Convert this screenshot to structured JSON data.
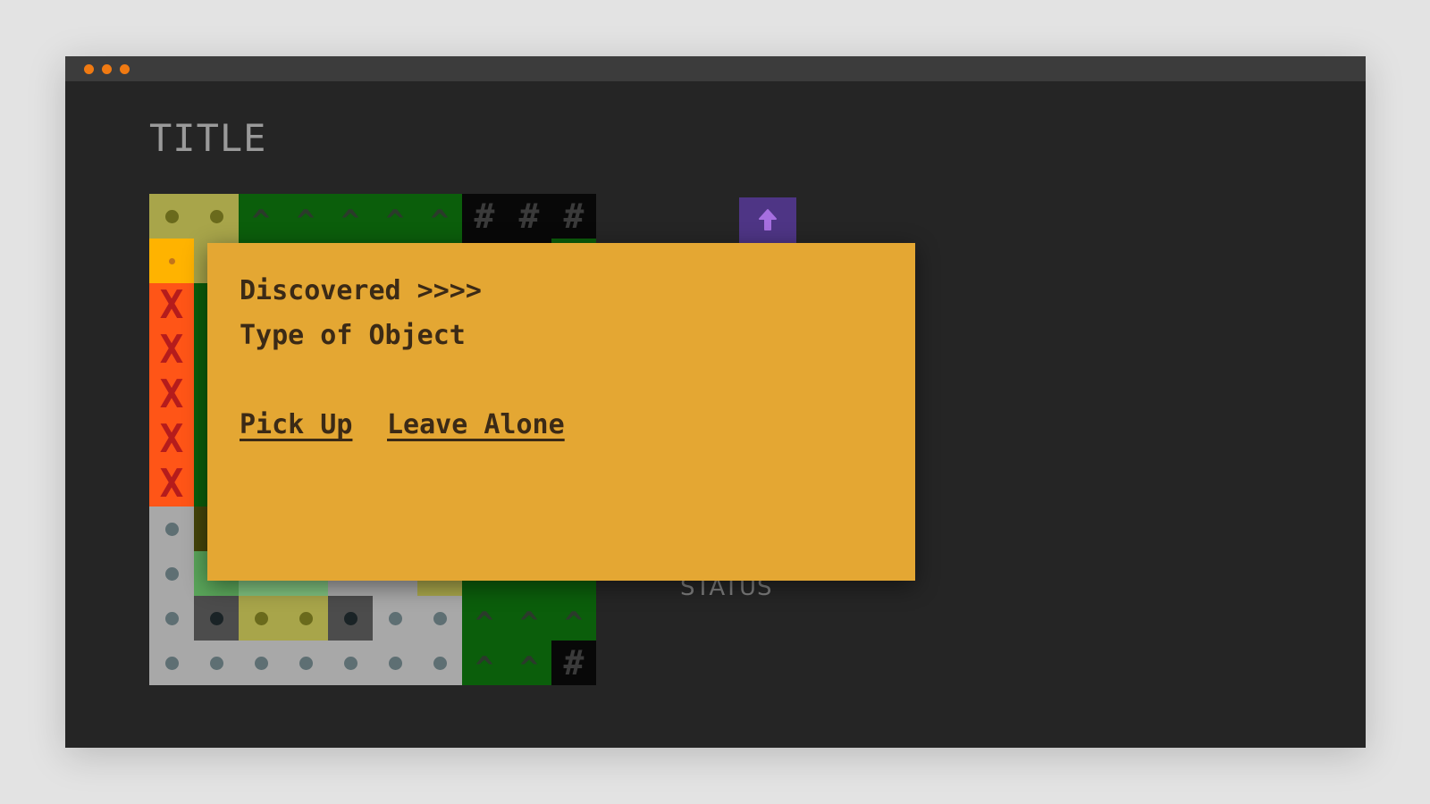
{
  "window": {
    "controls": [
      "dot",
      "dot",
      "dot"
    ],
    "control_color": "#f07a12"
  },
  "header": {
    "title": "TITLE"
  },
  "status": {
    "label": "STATUS"
  },
  "player": {
    "icon": "arrow-up-icon",
    "color": "#4e3585"
  },
  "colors": {
    "sand": "#a8a54a",
    "sand_dot": "#6a6a1c",
    "forest": "#0b5e0b",
    "forest_dark": "#074a07",
    "forest_glyph": "#2b3a2b",
    "rock": "#080808",
    "rock_glyph": "#3a3a3a",
    "lava_orange": "#ff5517",
    "lava_red": "#e2410f",
    "lava_x": "#b51c1c",
    "gold": "#ffb300",
    "gold_dot": "#c2751b",
    "stone": "#a8a8a8",
    "stone_dot": "#5e6f73",
    "dark_stone": "#4c4c4c",
    "dark_stone_dot": "#1a2326",
    "olive": "#45450a",
    "grass": "#5aa65a",
    "grass_light": "#7ec07e",
    "mud": "#6a5a1c",
    "dialog": "#e4a733",
    "dialog_text": "#3b2a16"
  },
  "map": {
    "rows": [
      [
        "sand",
        "sand",
        "forest",
        "forest",
        "forest",
        "forest",
        "forest",
        "rock",
        "rock",
        "rock"
      ],
      [
        "gold",
        "sand",
        "forest",
        "forest",
        "forest",
        "forest",
        "forest",
        "rock",
        "rock",
        "forest"
      ],
      [
        "lava",
        "forest",
        "forest",
        "forest",
        "forest",
        "forest",
        "forest",
        "forest",
        "forest",
        "forest"
      ],
      [
        "lava",
        "forest",
        "forest",
        "forest",
        "forest",
        "forest",
        "forest",
        "forest",
        "forest",
        "forest"
      ],
      [
        "lava",
        "forest",
        "forest",
        "forest",
        "forest",
        "forest",
        "forest",
        "forest",
        "forest",
        "forest"
      ],
      [
        "lava",
        "forest",
        "forest",
        "forest",
        "forest",
        "forest",
        "forest",
        "forest",
        "forest",
        "forest"
      ],
      [
        "lava",
        "forest",
        "forest",
        "forest",
        "forest",
        "forest",
        "forest",
        "forest",
        "forest",
        "forest"
      ],
      [
        "stone",
        "olive",
        "forest",
        "forest",
        "forest",
        "forest",
        "forest",
        "forest",
        "forest",
        "forest"
      ],
      [
        "stone",
        "grass",
        "grass-light",
        "grass-light",
        "stone",
        "stone",
        "sand",
        "forest",
        "forest",
        "forest"
      ],
      [
        "stone",
        "dark-stone",
        "sand",
        "sand",
        "dark-stone",
        "stone",
        "stone",
        "forest",
        "forest",
        "forest"
      ],
      [
        "stone",
        "stone",
        "stone",
        "stone",
        "stone",
        "stone",
        "stone",
        "forest",
        "forest",
        "rock"
      ]
    ]
  },
  "dialog": {
    "discovered": "Discovered >>>>",
    "object_type": "Type of Object",
    "pick_up_label": "Pick Up",
    "leave_alone_label": "Leave Alone"
  }
}
